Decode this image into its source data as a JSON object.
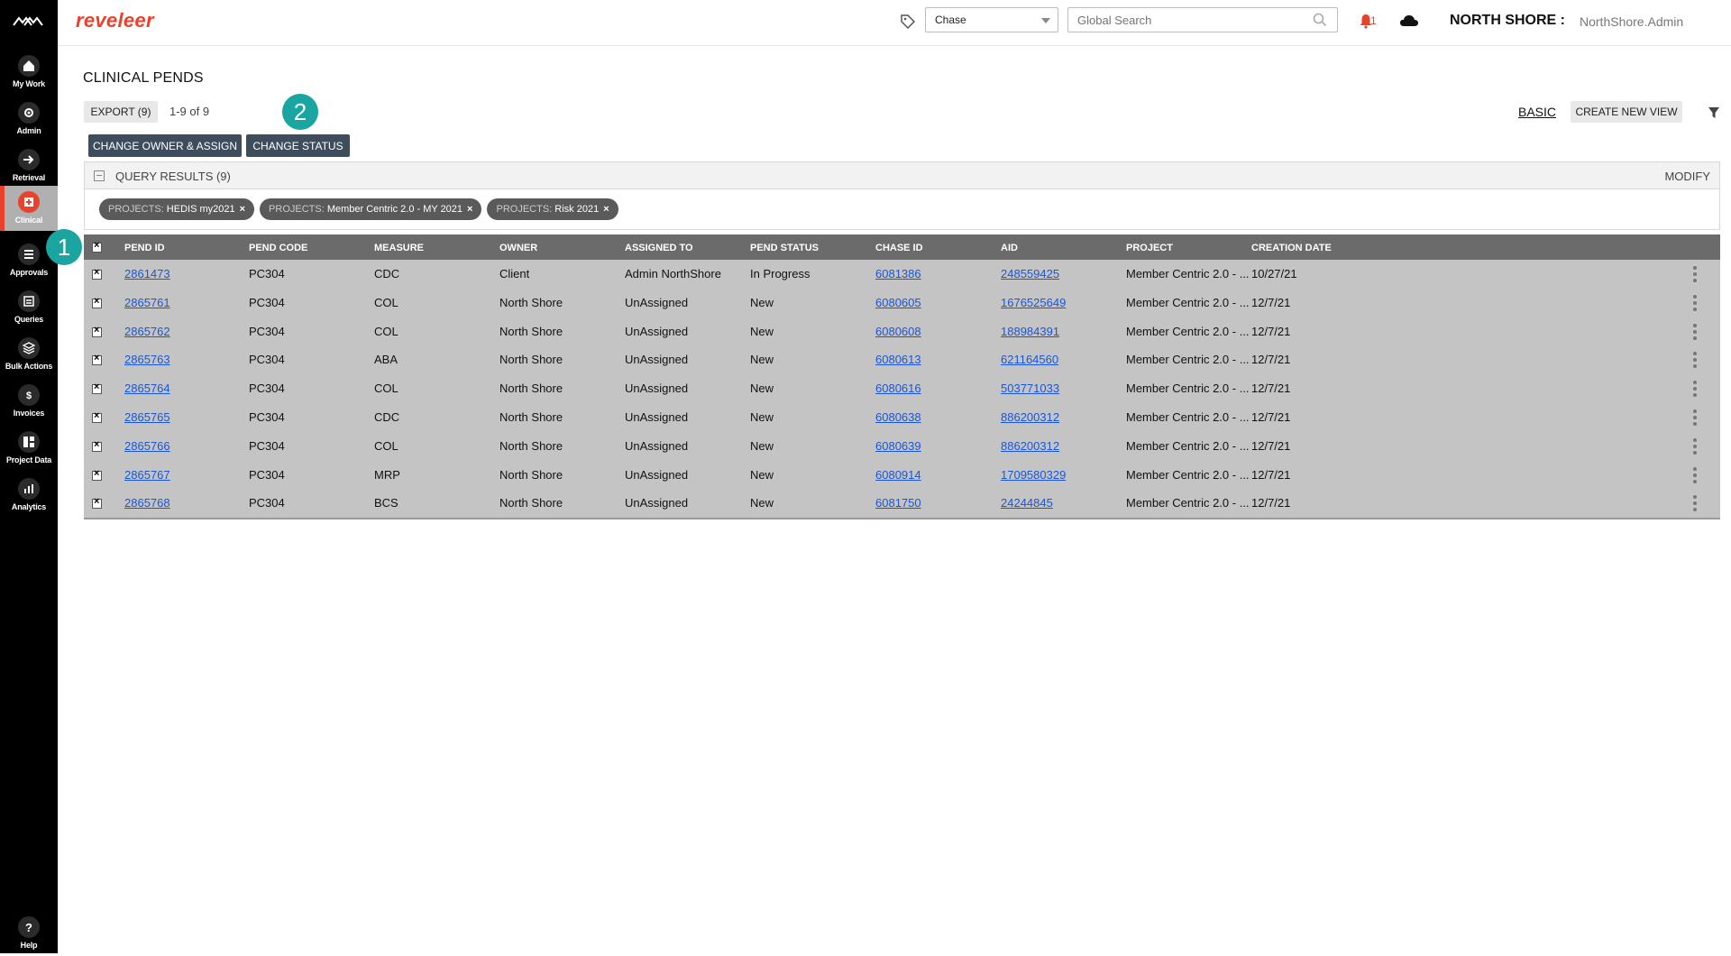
{
  "sidebar": {
    "items": [
      {
        "label": "My Work",
        "icon": "home-icon"
      },
      {
        "label": "Admin",
        "icon": "admin-icon"
      },
      {
        "label": "Retrieval",
        "icon": "retrieval-icon"
      },
      {
        "label": "Clinical",
        "icon": "clinical-icon"
      },
      {
        "label": "Approvals",
        "icon": "approvals-icon"
      },
      {
        "label": "Queries",
        "icon": "queries-icon"
      },
      {
        "label": "Bulk Actions",
        "icon": "bulk-actions-icon"
      },
      {
        "label": "Invoices",
        "icon": "invoices-icon"
      },
      {
        "label": "Project Data",
        "icon": "project-data-icon"
      },
      {
        "label": "Analytics",
        "icon": "analytics-icon"
      }
    ],
    "help_label": "Help"
  },
  "header": {
    "brand": "reveleer",
    "search_type": "Chase",
    "search_placeholder": "Global Search",
    "notification_count": "1",
    "org": "NORTH SHORE :",
    "user": "NorthShore.Admin"
  },
  "page": {
    "title": "CLINICAL PENDS",
    "export_label": "EXPORT (9)",
    "count_text": "1-9  of  9",
    "change_owner_label": "CHANGE OWNER & ASSIGN",
    "change_status_label": "CHANGE STATUS",
    "basic_label": "BASIC",
    "create_view_label": "CREATE NEW VIEW",
    "badge1": "1",
    "badge2": "2"
  },
  "query_results": {
    "title": "QUERY RESULTS (9)",
    "modify_label": "MODIFY",
    "filters": [
      {
        "key": "PROJECTS:",
        "value": "HEDIS my2021"
      },
      {
        "key": "PROJECTS:",
        "value": "Member Centric 2.0 - MY 2021"
      },
      {
        "key": "PROJECTS:",
        "value": "Risk 2021"
      }
    ]
  },
  "table": {
    "columns": [
      "PEND ID",
      "PEND CODE",
      "MEASURE",
      "OWNER",
      "ASSIGNED TO",
      "PEND STATUS",
      "CHASE ID",
      "AID",
      "PROJECT",
      "CREATION DATE"
    ],
    "rows": [
      [
        "2861473",
        "PC304",
        "CDC",
        "Client",
        "Admin NorthShore",
        "In Progress",
        "6081386",
        "248559425",
        "Member Centric 2.0 - ...",
        "10/27/21"
      ],
      [
        "2865761",
        "PC304",
        "COL",
        "North Shore",
        "UnAssigned",
        "New",
        "6080605",
        "1676525649",
        "Member Centric 2.0 - ...",
        "12/7/21"
      ],
      [
        "2865762",
        "PC304",
        "COL",
        "North Shore",
        "UnAssigned",
        "New",
        "6080608",
        "188984391",
        "Member Centric 2.0 - ...",
        "12/7/21"
      ],
      [
        "2865763",
        "PC304",
        "ABA",
        "North Shore",
        "UnAssigned",
        "New",
        "6080613",
        "621164560",
        "Member Centric 2.0 - ...",
        "12/7/21"
      ],
      [
        "2865764",
        "PC304",
        "COL",
        "North Shore",
        "UnAssigned",
        "New",
        "6080616",
        "503771033",
        "Member Centric 2.0 - ...",
        "12/7/21"
      ],
      [
        "2865765",
        "PC304",
        "CDC",
        "North Shore",
        "UnAssigned",
        "New",
        "6080638",
        "886200312",
        "Member Centric 2.0 - ...",
        "12/7/21"
      ],
      [
        "2865766",
        "PC304",
        "COL",
        "North Shore",
        "UnAssigned",
        "New",
        "6080639",
        "886200312",
        "Member Centric 2.0 - ...",
        "12/7/21"
      ],
      [
        "2865767",
        "PC304",
        "MRP",
        "North Shore",
        "UnAssigned",
        "New",
        "6080914",
        "1709580329",
        "Member Centric 2.0 - ...",
        "12/7/21"
      ],
      [
        "2865768",
        "PC304",
        "BCS",
        "North Shore",
        "UnAssigned",
        "New",
        "6081750",
        "24244845",
        "Member Centric 2.0 - ...",
        "12/7/21"
      ]
    ]
  },
  "colors": {
    "brand": "#e8412c",
    "link": "#1a56d6",
    "badge": "#1aa5a1",
    "dark_button": "#3d4d5c"
  }
}
